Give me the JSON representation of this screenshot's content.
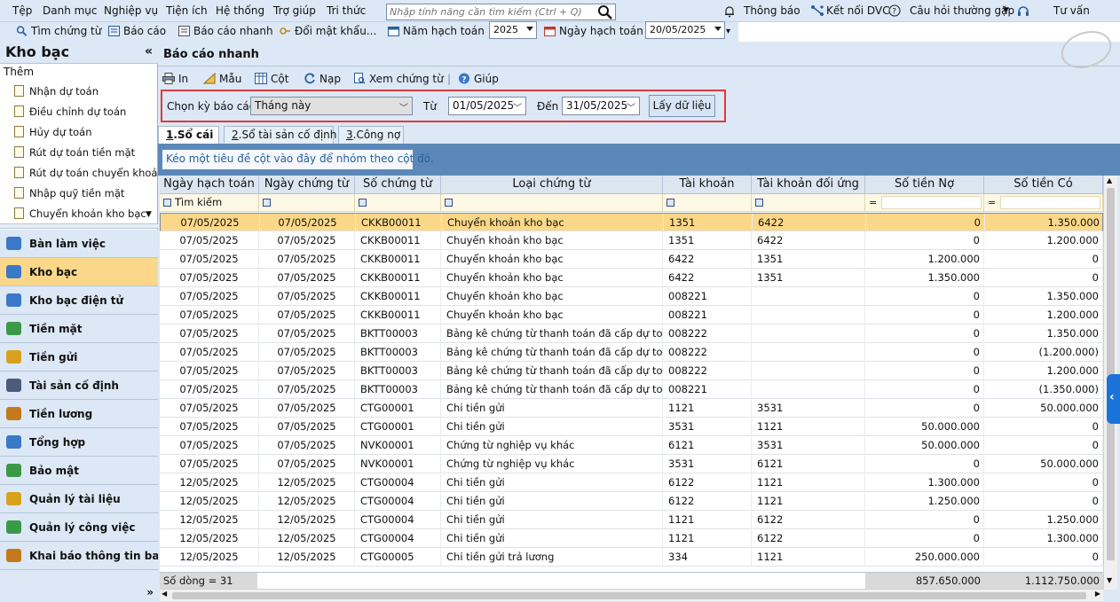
{
  "menu": [
    "Tệp",
    "Danh mục",
    "Nghiệp vụ",
    "Tiện ích",
    "Hệ thống",
    "Trợ giúp",
    "Tri thức"
  ],
  "search": {
    "placeholder": "Nhập tính năng cần tìm kiếm (Ctrl + Q)"
  },
  "right_menu": {
    "notify": "Thông báo",
    "connect": "Kết nối DVC",
    "faq": "Câu hỏi thường gặp",
    "advice": "Tư vấn"
  },
  "toolbar": {
    "find_voucher": "Tìm chứng từ",
    "report": "Báo cáo",
    "quick_report": "Báo cáo nhanh",
    "change_password": "Đổi mật khẩu...",
    "fiscal_year_label": "Năm hạch toán",
    "fiscal_year": "2025",
    "posting_date_label": "Ngày hạch toán",
    "posting_date": "20/05/2025"
  },
  "sidebar": {
    "title": "Kho bạc",
    "collapse": "«",
    "sub_header": "Thêm",
    "items": [
      "Nhận dự toán",
      "Điều chỉnh dự toán",
      "Hủy dự toán",
      "Rút dự toán tiền mặt",
      "Rút dự toán chuyển khoản",
      "Nhập quỹ tiền mặt",
      "Chuyển khoản kho bạc"
    ],
    "nav": [
      {
        "label": "Bàn làm việc",
        "icon": "desk-icon",
        "color": "#3a78c8"
      },
      {
        "label": "Kho bạc",
        "icon": "treasury-icon",
        "color": "#3a78c8"
      },
      {
        "label": "Kho bạc điện tử",
        "icon": "etreasury-icon",
        "color": "#3a78c8"
      },
      {
        "label": "Tiền mặt",
        "icon": "cash-icon",
        "color": "#3a9a48"
      },
      {
        "label": "Tiền gửi",
        "icon": "deposit-icon",
        "color": "#d8a21f"
      },
      {
        "label": "Tài sản cố định",
        "icon": "asset-icon",
        "color": "#4b5b7a"
      },
      {
        "label": "Tiền lương",
        "icon": "salary-icon",
        "color": "#c27a1a"
      },
      {
        "label": "Tổng hợp",
        "icon": "summary-icon",
        "color": "#3a78c8"
      },
      {
        "label": "Bảo mật",
        "icon": "security-icon",
        "color": "#3a9a48"
      },
      {
        "label": "Quản lý tài liệu",
        "icon": "documents-icon",
        "color": "#d8a21f"
      },
      {
        "label": "Quản lý công việc",
        "icon": "tasks-icon",
        "color": "#3a9a48"
      },
      {
        "label": "Khai báo thông tin ba...",
        "icon": "declare-icon",
        "color": "#c27a1a"
      }
    ],
    "active_nav": "Kho bạc",
    "more": "»"
  },
  "main": {
    "title": "Báo cáo nhanh",
    "toolbar": {
      "print": "In",
      "template": "Mẫu",
      "columns": "Cột",
      "reload": "Nạp",
      "view_voucher": "Xem chứng từ",
      "help": "Giúp"
    },
    "period_label": "Chọn kỳ báo cáo",
    "period_value": "Tháng này",
    "from_label": "Từ",
    "from_value": "01/05/2025",
    "to_label": "Đến",
    "to_value": "31/05/2025",
    "fetch_button": "Lấy dữ liệu",
    "tabs": [
      {
        "num": "1",
        "label": ".Sổ cái"
      },
      {
        "num": "2",
        "label": ".Sổ tài sản cố định"
      },
      {
        "num": "3",
        "label": ".Công nợ"
      }
    ],
    "group_hint": "Kéo một tiêu đề cột vào đây để nhóm theo cột đó.",
    "columns": [
      "Ngày hạch toán",
      "Ngày chứng từ",
      "Số chứng từ",
      "Loại chứng từ",
      "Tài khoản",
      "Tài khoản đối ứng",
      "Số tiền Nợ",
      "Số tiền Có"
    ],
    "filter_placeholder": "Tìm kiếm",
    "filter_ops": [
      "",
      "",
      "",
      "",
      "",
      "",
      "=",
      "="
    ],
    "rows": [
      [
        "07/05/2025",
        "07/05/2025",
        "CKKB00011",
        "Chuyển khoản kho bạc",
        "1351",
        "6422",
        "0",
        "1.350.000"
      ],
      [
        "07/05/2025",
        "07/05/2025",
        "CKKB00011",
        "Chuyển khoản kho bạc",
        "1351",
        "6422",
        "0",
        "1.200.000"
      ],
      [
        "07/05/2025",
        "07/05/2025",
        "CKKB00011",
        "Chuyển khoản kho bạc",
        "6422",
        "1351",
        "1.200.000",
        "0"
      ],
      [
        "07/05/2025",
        "07/05/2025",
        "CKKB00011",
        "Chuyển khoản kho bạc",
        "6422",
        "1351",
        "1.350.000",
        "0"
      ],
      [
        "07/05/2025",
        "07/05/2025",
        "CKKB00011",
        "Chuyển khoản kho bạc",
        "008221",
        "",
        "0",
        "1.350.000"
      ],
      [
        "07/05/2025",
        "07/05/2025",
        "CKKB00011",
        "Chuyển khoản kho bạc",
        "008221",
        "",
        "0",
        "1.200.000"
      ],
      [
        "07/05/2025",
        "07/05/2025",
        "BKTT00003",
        "Bảng kê chứng từ thanh toán đã cấp dự toán",
        "008222",
        "",
        "0",
        "1.350.000"
      ],
      [
        "07/05/2025",
        "07/05/2025",
        "BKTT00003",
        "Bảng kê chứng từ thanh toán đã cấp dự toán",
        "008222",
        "",
        "0",
        "(1.200.000)"
      ],
      [
        "07/05/2025",
        "07/05/2025",
        "BKTT00003",
        "Bảng kê chứng từ thanh toán đã cấp dự toán",
        "008222",
        "",
        "0",
        "1.200.000"
      ],
      [
        "07/05/2025",
        "07/05/2025",
        "BKTT00003",
        "Bảng kê chứng từ thanh toán đã cấp dự toán",
        "008221",
        "",
        "0",
        "(1.350.000)"
      ],
      [
        "07/05/2025",
        "07/05/2025",
        "CTG00001",
        "Chi tiền gửi",
        "1121",
        "3531",
        "0",
        "50.000.000"
      ],
      [
        "07/05/2025",
        "07/05/2025",
        "CTG00001",
        "Chi tiền gửi",
        "3531",
        "1121",
        "50.000.000",
        "0"
      ],
      [
        "07/05/2025",
        "07/05/2025",
        "NVK00001",
        "Chứng từ nghiệp vụ khác",
        "6121",
        "3531",
        "50.000.000",
        "0"
      ],
      [
        "07/05/2025",
        "07/05/2025",
        "NVK00001",
        "Chứng từ nghiệp vụ khác",
        "3531",
        "6121",
        "0",
        "50.000.000"
      ],
      [
        "12/05/2025",
        "12/05/2025",
        "CTG00004",
        "Chi tiền gửi",
        "6122",
        "1121",
        "1.300.000",
        "0"
      ],
      [
        "12/05/2025",
        "12/05/2025",
        "CTG00004",
        "Chi tiền gửi",
        "6122",
        "1121",
        "1.250.000",
        "0"
      ],
      [
        "12/05/2025",
        "12/05/2025",
        "CTG00004",
        "Chi tiền gửi",
        "1121",
        "6122",
        "0",
        "1.250.000"
      ],
      [
        "12/05/2025",
        "12/05/2025",
        "CTG00004",
        "Chi tiền gửi",
        "1121",
        "6122",
        "0",
        "1.300.000"
      ],
      [
        "12/05/2025",
        "12/05/2025",
        "CTG00005",
        "Chi tiền gửi trả lương",
        "334",
        "1121",
        "250.000.000",
        "0"
      ]
    ],
    "footer": {
      "row_count": "Số dòng = 31",
      "total_debit": "857.650.000",
      "total_credit": "1.112.750.000"
    }
  }
}
